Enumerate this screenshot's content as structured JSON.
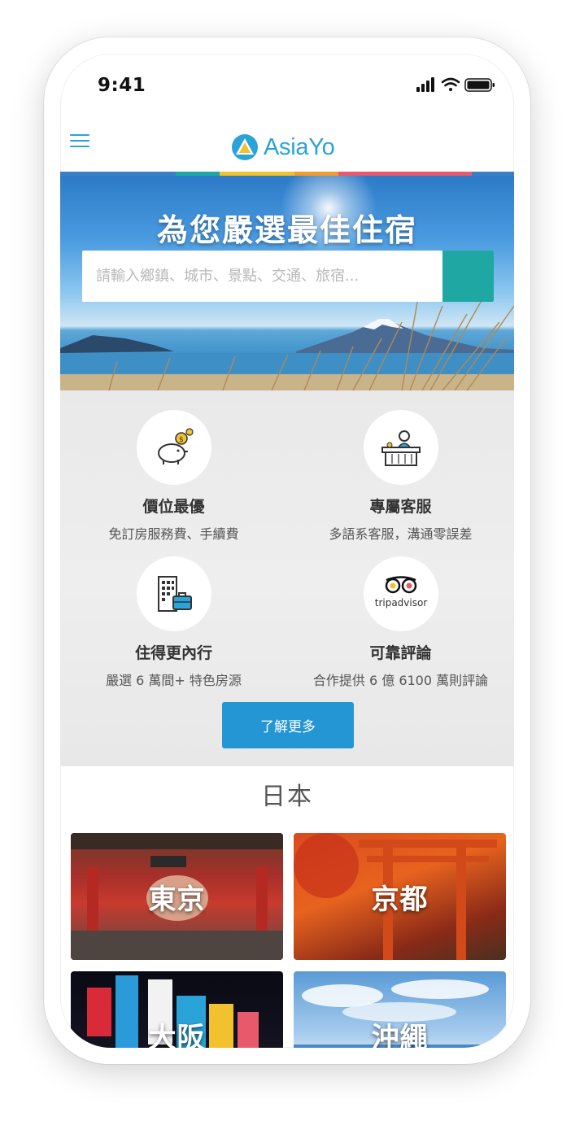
{
  "status_bar": {
    "time": "9:41"
  },
  "header": {
    "logo_text": "AsiaYo"
  },
  "hero": {
    "title": "為您嚴選最佳住宿",
    "search_placeholder": "請輸入鄉鎮、城市、景點、交通、旅宿..."
  },
  "features": [
    {
      "title": "價位最優",
      "desc": "免訂房服務費、手續費",
      "icon": "piggy-bank-icon"
    },
    {
      "title": "專屬客服",
      "desc": "多語系客服，溝通零誤差",
      "icon": "customer-service-icon"
    },
    {
      "title": "住得更內行",
      "desc": "嚴選 6 萬間+ 特色房源",
      "icon": "building-suitcase-icon"
    },
    {
      "title": "可靠評論",
      "desc": "合作提供 6 億 6100 萬則評論",
      "icon": "tripadvisor-icon"
    }
  ],
  "tripadvisor_text": "tripadvisor",
  "learn_more_label": "了解更多",
  "section_title": "日本",
  "destinations": [
    {
      "label": "東京"
    },
    {
      "label": "京都"
    },
    {
      "label": "大阪"
    },
    {
      "label": "沖繩"
    }
  ],
  "colors": {
    "brand_blue": "#2aa3d8",
    "search_button": "#1fa7a3",
    "learn_more_button": "#2596d4",
    "rainbow": [
      "#3a7fc4",
      "#1fa7a3",
      "#f2c12e",
      "#f29b30",
      "#e85a6b"
    ]
  }
}
